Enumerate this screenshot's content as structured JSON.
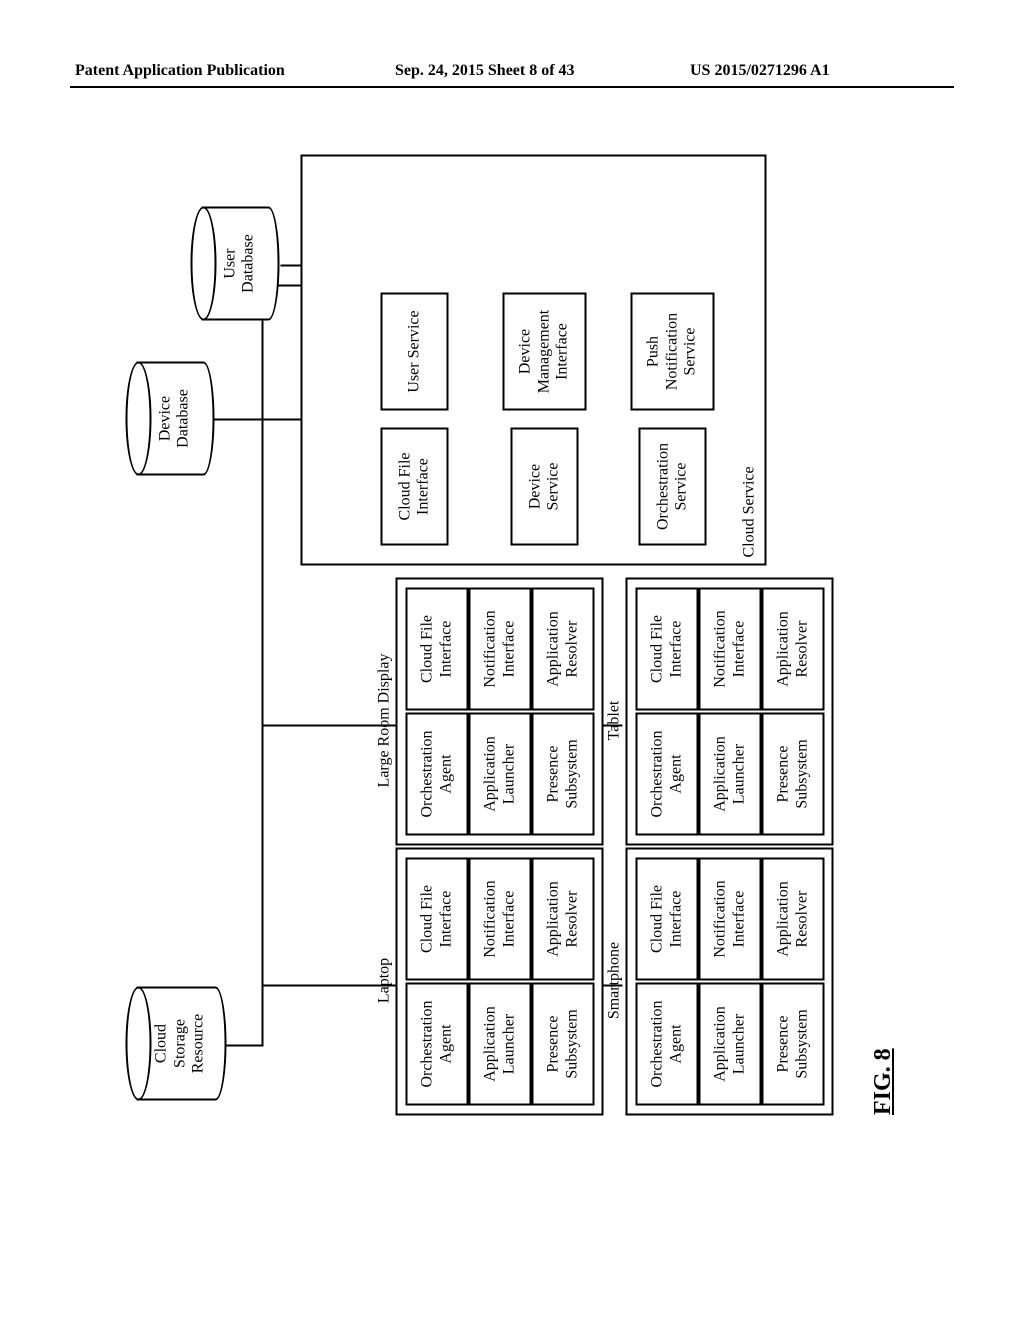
{
  "header": {
    "left": "Patent Application Publication",
    "center": "Sep. 24, 2015  Sheet 8 of 43",
    "right": "US 2015/0271296 A1"
  },
  "figure": {
    "caption": "FIG. 8",
    "cloud_service_label": "Cloud Service"
  },
  "cylinders": {
    "cloud_storage": "Cloud\nStorage\nResource",
    "device_db": "Device\nDatabase",
    "user_db": "User\nDatabase"
  },
  "cloud": {
    "cloud_file_interface": "Cloud File\nInterface",
    "user_service": "User Service",
    "device_service": "Device\nService",
    "device_mgmt_interface": "Device\nManagement\nInterface",
    "orchestration_service": "Orchestration\nService",
    "push_notification_service": "Push\nNotification\nService"
  },
  "device_block": {
    "orchestration_agent": "Orchestration\nAgent",
    "cloud_file_interface": "Cloud File\nInterface",
    "application_launcher": "Application\nLauncher",
    "notification_interface": "Notification\nInterface",
    "presence_subsystem": "Presence\nSubsystem",
    "application_resolver": "Application\nResolver"
  },
  "devices": {
    "laptop": "Laptop",
    "large_room_display": "Large Room Display",
    "smartphone": "Smartphone",
    "tablet": "Tablet"
  }
}
